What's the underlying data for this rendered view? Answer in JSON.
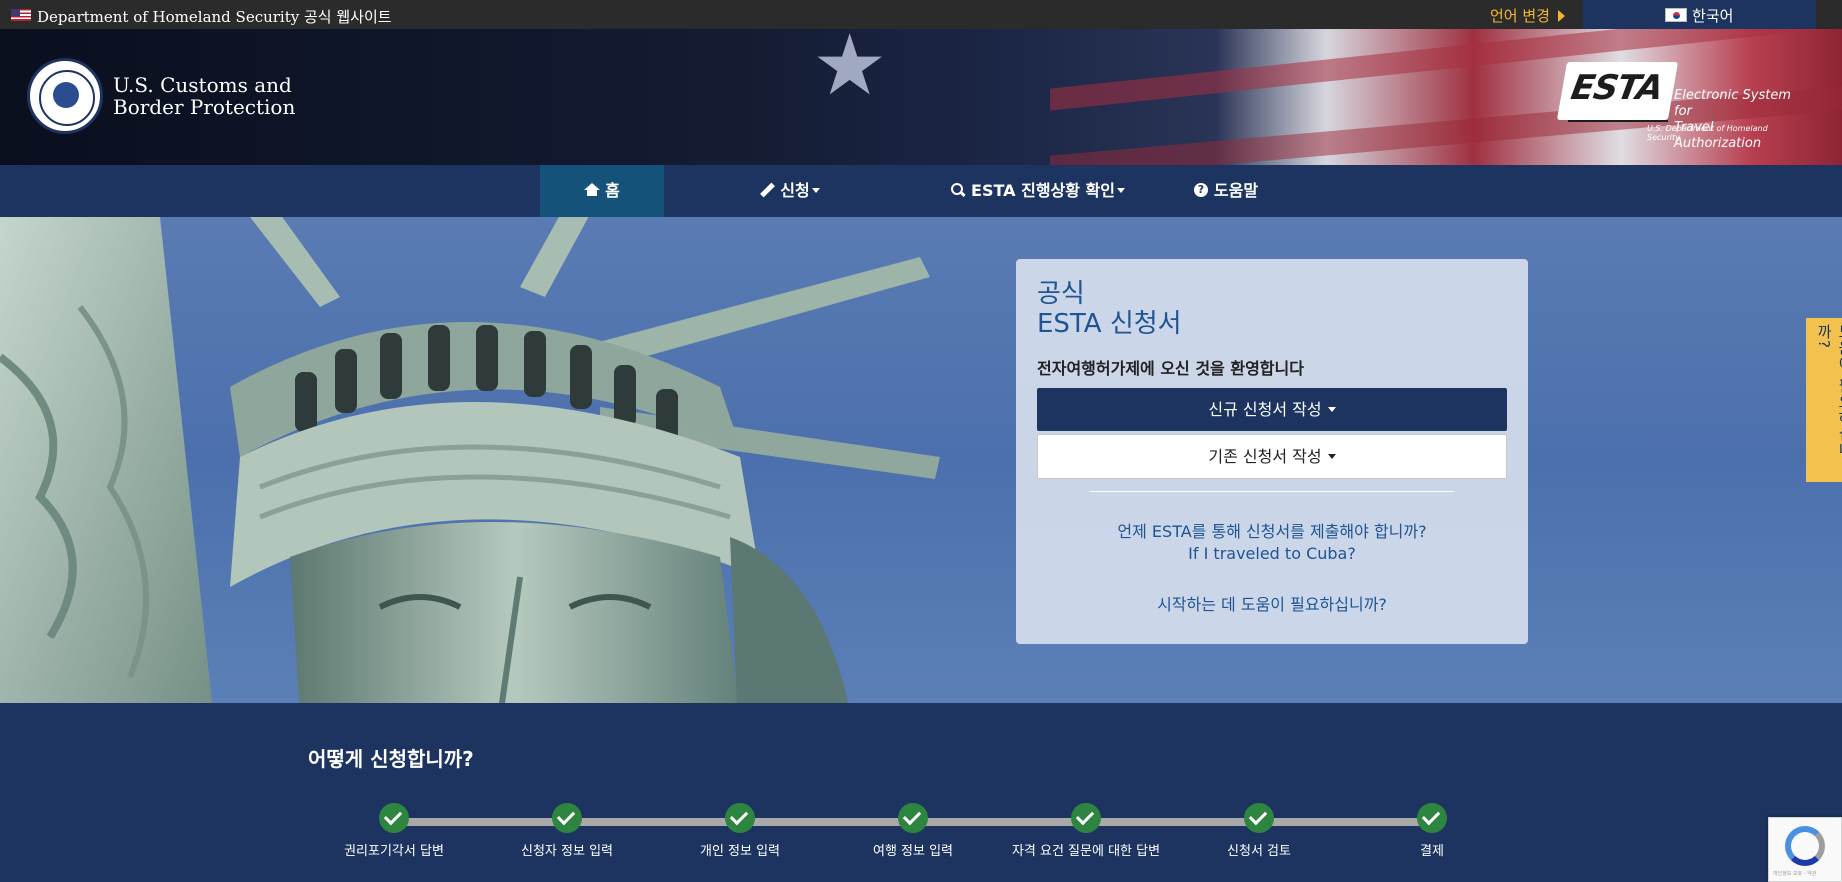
{
  "topbar": {
    "gov_site": "Department of Homeland Security 공식 웹사이트",
    "change_language": "언어 변경",
    "current_language": "한국어"
  },
  "header": {
    "agency_line1": "U.S. Customs and",
    "agency_line2": "Border Protection",
    "esta_mark": "ESTA",
    "esta_full_line1": "Electronic System for",
    "esta_full_line2": "Travel Authorization",
    "esta_dept": "U.S. Department of Homeland Security"
  },
  "nav": {
    "home": "홈",
    "apply": "신청",
    "check_status": "ESTA 진행상황 확인",
    "help": "도움말"
  },
  "card": {
    "title_line1": "공식",
    "title_line2": "ESTA 신청서",
    "welcome": "전자여행허가제에 오신 것을 환영합니다",
    "new_application": "신규 신청서 작성",
    "existing_application": "기존 신청서 작성",
    "when_to_apply": "언제 ESTA를 통해 신청서를 제출해야 합니까?",
    "cuba": "If I traveled to Cuba?",
    "need_help": "시작하는 데 도움이 필요하십니까?"
  },
  "side_help": "도움이 필요하십니까?",
  "how_to_apply": {
    "heading": "어떻게 신청합니까?",
    "steps": [
      "권리포기각서 답변",
      "신청자 정보 입력",
      "개인 정보 입력",
      "여행 정보 입력",
      "자격 요건 질문에 대한 답변",
      "신청서 검토",
      "결제"
    ]
  },
  "recaptcha_text": "개인정보 보호 - 약관",
  "colors": {
    "navy": "#1d3461",
    "link_blue": "#205493",
    "accent_gold": "#f2b632",
    "step_green": "#2e8540"
  }
}
